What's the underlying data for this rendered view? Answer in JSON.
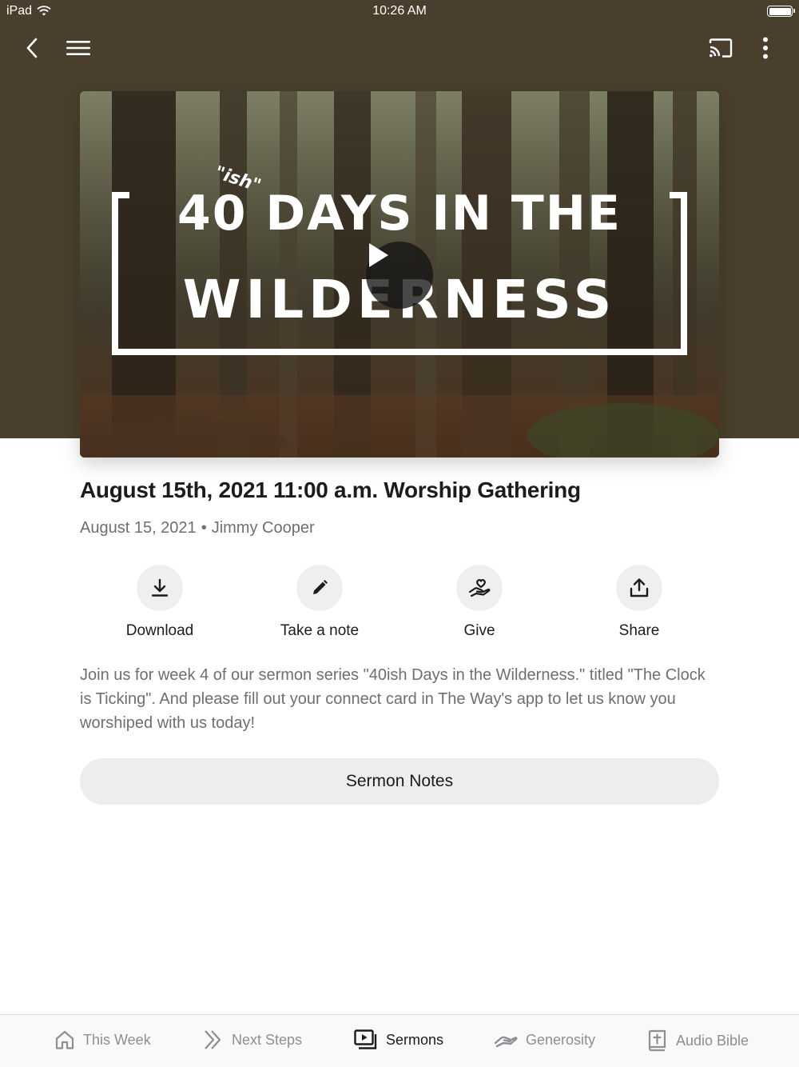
{
  "status_bar": {
    "device": "iPad",
    "time": "10:26 AM"
  },
  "nav": {
    "back_icon": "chevron-left-icon",
    "menu_icon": "hamburger-menu-icon",
    "cast_icon": "cast-icon",
    "more_icon": "more-vertical-icon"
  },
  "artwork": {
    "line1": "40 DAYS IN THE",
    "ish": "\"ish\"",
    "line2": "WILDERNESS",
    "play_icon": "play-icon"
  },
  "sermon": {
    "title": "August 15th, 2021 11:00 a.m. Worship Gathering",
    "date": "August 15, 2021",
    "separator": "•",
    "speaker": "Jimmy Cooper",
    "description": "Join us for week 4 of our sermon series \"40ish Days in the Wilderness.\" titled \"The Clock is Ticking\". And please fill out your connect card in The Way's app to let us know you worshiped with us today!"
  },
  "actions": [
    {
      "label": "Download",
      "icon": "download-icon"
    },
    {
      "label": "Take a note",
      "icon": "pencil-icon"
    },
    {
      "label": "Give",
      "icon": "give-heart-hand-icon"
    },
    {
      "label": "Share",
      "icon": "share-icon"
    }
  ],
  "notes_button": {
    "label": "Sermon Notes"
  },
  "tabs": [
    {
      "label": "This Week",
      "icon": "home-icon",
      "active": false
    },
    {
      "label": "Next Steps",
      "icon": "double-chevron-right-icon",
      "active": false
    },
    {
      "label": "Sermons",
      "icon": "video-play-icon",
      "active": true
    },
    {
      "label": "Generosity",
      "icon": "generosity-hand-icon",
      "active": false
    },
    {
      "label": "Audio Bible",
      "icon": "bible-icon",
      "active": false
    }
  ],
  "colors": {
    "header_bg": "#4a3f2c",
    "active_tab": "#1c1c1e",
    "inactive_tab": "#8e8e93",
    "button_bg": "#ededef"
  }
}
